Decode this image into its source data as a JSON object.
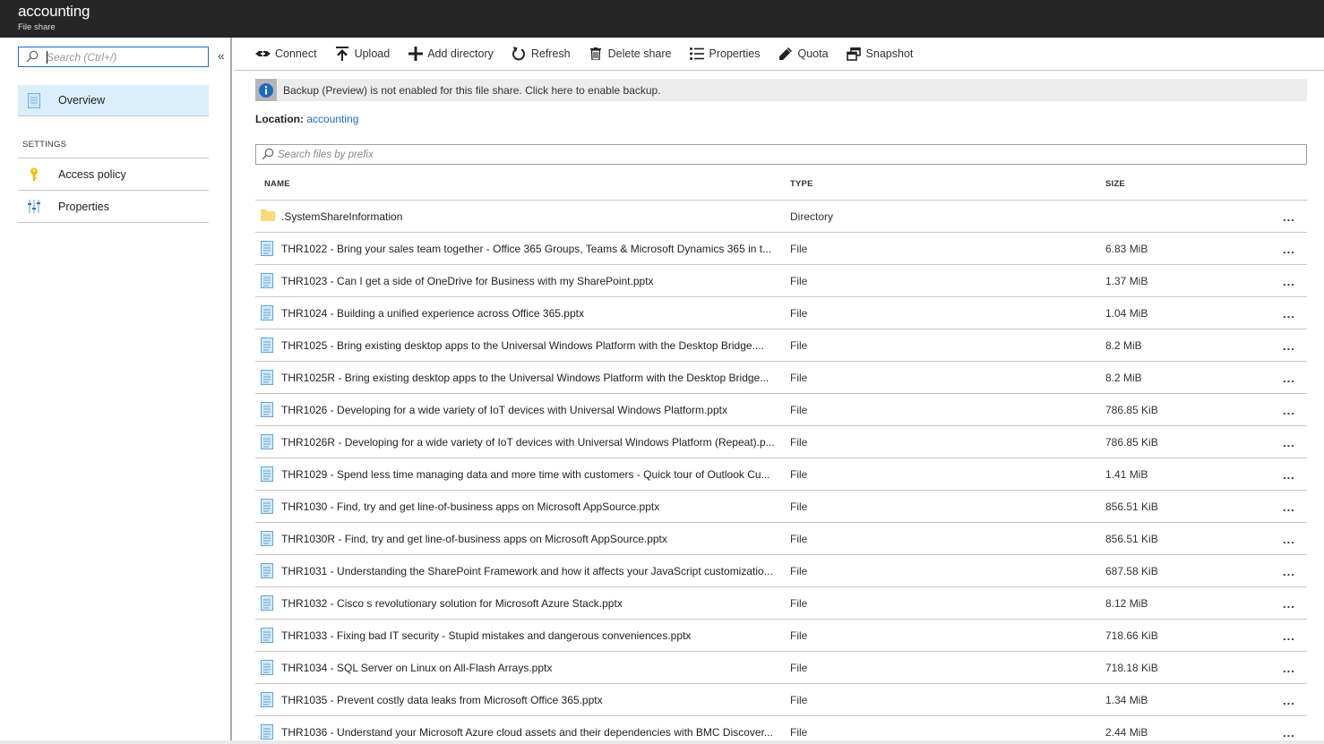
{
  "header": {
    "title": "accounting",
    "subtitle": "File share"
  },
  "sidebar": {
    "search_placeholder": "Search (Ctrl+/)",
    "collapse_icon": "«",
    "items": [
      {
        "label": "Overview",
        "icon": "document-icon",
        "active": true
      }
    ],
    "section_label": "SETTINGS",
    "settings_items": [
      {
        "label": "Access policy",
        "icon": "key-icon"
      },
      {
        "label": "Properties",
        "icon": "sliders-icon"
      }
    ]
  },
  "toolbar": {
    "buttons": [
      {
        "label": "Connect",
        "icon": "connect-icon"
      },
      {
        "label": "Upload",
        "icon": "upload-icon"
      },
      {
        "label": "Add directory",
        "icon": "plus-icon"
      },
      {
        "label": "Refresh",
        "icon": "refresh-icon"
      },
      {
        "label": "Delete share",
        "icon": "trash-icon"
      },
      {
        "label": "Properties",
        "icon": "list-icon"
      },
      {
        "label": "Quota",
        "icon": "pencil-icon"
      },
      {
        "label": "Snapshot",
        "icon": "snapshot-icon"
      }
    ]
  },
  "banner": {
    "icon": "info-icon",
    "message": "Backup (Preview) is not enabled for this file share. Click here to enable backup."
  },
  "location": {
    "label": "Location:",
    "value": "accounting"
  },
  "file_search": {
    "placeholder": "Search files by prefix"
  },
  "table": {
    "columns": {
      "name": "NAME",
      "type": "TYPE",
      "size": "SIZE"
    },
    "more_label": "...",
    "rows": [
      {
        "name": ".SystemShareInformation",
        "type": "Directory",
        "size": "",
        "kind": "folder"
      },
      {
        "name": "THR1022 - Bring your sales team together - Office 365 Groups, Teams & Microsoft Dynamics 365 in t...",
        "type": "File",
        "size": "6.83 MiB",
        "kind": "file"
      },
      {
        "name": "THR1023 - Can I get a side of OneDrive for Business with my SharePoint.pptx",
        "type": "File",
        "size": "1.37 MiB",
        "kind": "file"
      },
      {
        "name": "THR1024 - Building a unified experience across Office 365.pptx",
        "type": "File",
        "size": "1.04 MiB",
        "kind": "file"
      },
      {
        "name": "THR1025 - Bring existing desktop apps to the Universal Windows Platform with the Desktop Bridge....",
        "type": "File",
        "size": "8.2 MiB",
        "kind": "file"
      },
      {
        "name": "THR1025R - Bring existing desktop apps to the Universal Windows Platform with the Desktop Bridge...",
        "type": "File",
        "size": "8.2 MiB",
        "kind": "file"
      },
      {
        "name": "THR1026 - Developing for a wide variety of IoT devices with Universal Windows Platform.pptx",
        "type": "File",
        "size": "786.85 KiB",
        "kind": "file"
      },
      {
        "name": "THR1026R - Developing for a wide variety of IoT devices with Universal Windows Platform (Repeat).p...",
        "type": "File",
        "size": "786.85 KiB",
        "kind": "file"
      },
      {
        "name": "THR1029 - Spend less time managing data and more time with customers - Quick tour of Outlook Cu...",
        "type": "File",
        "size": "1.41 MiB",
        "kind": "file"
      },
      {
        "name": "THR1030 - Find, try and get line-of-business apps on Microsoft AppSource.pptx",
        "type": "File",
        "size": "856.51 KiB",
        "kind": "file"
      },
      {
        "name": "THR1030R - Find, try and get line-of-business apps on Microsoft AppSource.pptx",
        "type": "File",
        "size": "856.51 KiB",
        "kind": "file"
      },
      {
        "name": "THR1031 - Understanding the SharePoint Framework and how it affects your JavaScript customizatio...",
        "type": "File",
        "size": "687.58 KiB",
        "kind": "file"
      },
      {
        "name": "THR1032 - Cisco s revolutionary solution for Microsoft Azure Stack.pptx",
        "type": "File",
        "size": "8.12 MiB",
        "kind": "file"
      },
      {
        "name": "THR1033 - Fixing bad IT security - Stupid mistakes and dangerous conveniences.pptx",
        "type": "File",
        "size": "718.66 KiB",
        "kind": "file"
      },
      {
        "name": "THR1034 - SQL Server on Linux on All-Flash Arrays.pptx",
        "type": "File",
        "size": "718.18 KiB",
        "kind": "file"
      },
      {
        "name": "THR1035 - Prevent costly data leaks from Microsoft Office 365.pptx",
        "type": "File",
        "size": "1.34 MiB",
        "kind": "file"
      },
      {
        "name": "THR1036 - Understand your Microsoft Azure cloud assets and their dependencies with BMC Discover...",
        "type": "File",
        "size": "2.44 MiB",
        "kind": "file"
      }
    ]
  },
  "colors": {
    "topbar": "#262626",
    "accent": "#1e6ac2",
    "active_nav": "#dbeefc",
    "banner_bg": "#ececec",
    "folder": "#f5d66e",
    "file_icon": "#5ea7dd"
  }
}
